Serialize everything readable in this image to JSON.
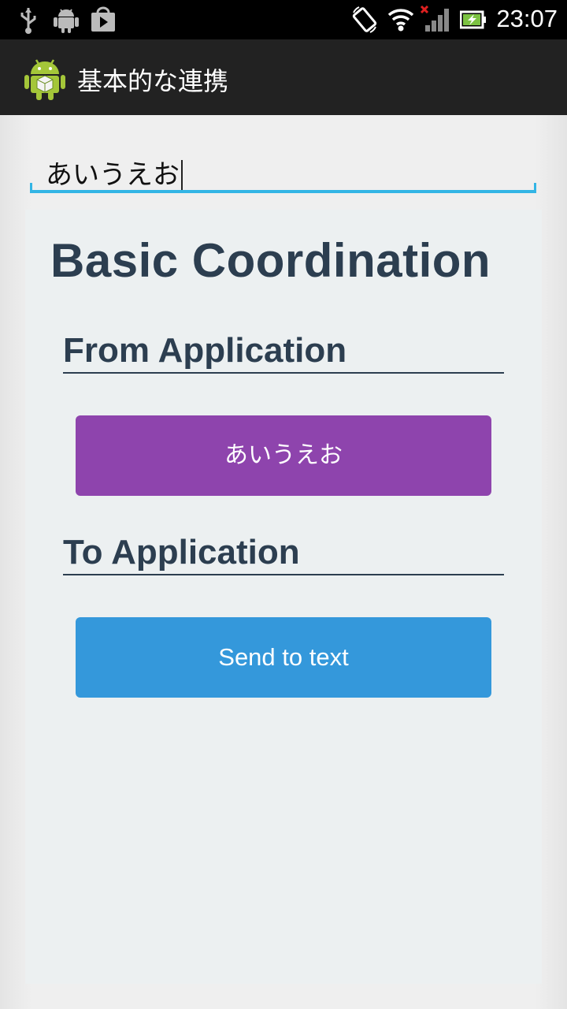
{
  "status_bar": {
    "time": "23:07",
    "icons": [
      "usb-icon",
      "android-debug-icon",
      "play-store-icon",
      "rotate-icon",
      "wifi-icon",
      "signal-no-service-icon",
      "battery-charging-icon"
    ]
  },
  "action_bar": {
    "app_icon": "android-app-icon",
    "title": "基本的な連携"
  },
  "input": {
    "value": "あいうえお"
  },
  "webview": {
    "heading": "Basic Coordination",
    "from_section": {
      "title": "From Application",
      "button_label": "あいうえお"
    },
    "to_section": {
      "title": "To Application",
      "button_label": "Send to text"
    }
  },
  "colors": {
    "heading": "#2c3e50",
    "purple_button": "#8e44ad",
    "blue_button": "#3498db",
    "input_focus": "#33b5e5",
    "panel_bg": "#ecf0f1"
  }
}
